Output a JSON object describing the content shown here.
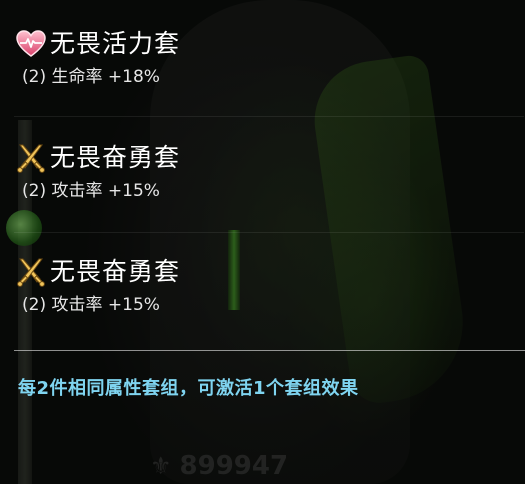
{
  "sets": [
    {
      "icon": "heart-icon",
      "name": "无畏活力套",
      "bonus": "(2) 生命率 +18%"
    },
    {
      "icon": "crossed-swords-icon",
      "name": "无畏奋勇套",
      "bonus": "(2) 攻击率 +15%"
    },
    {
      "icon": "crossed-swords-icon",
      "name": "无畏奋勇套",
      "bonus": "(2) 攻击率 +15%"
    }
  ],
  "hint": "每2件相同属性套组，可激活1个套组效果",
  "background": {
    "power_value": "899947"
  },
  "colors": {
    "title": "#ffffff",
    "bonus": "#e6e6e6",
    "hint": "#7fd4f0",
    "heart_icon": "#e85a7a",
    "sword_icon": "#e8c15a"
  }
}
